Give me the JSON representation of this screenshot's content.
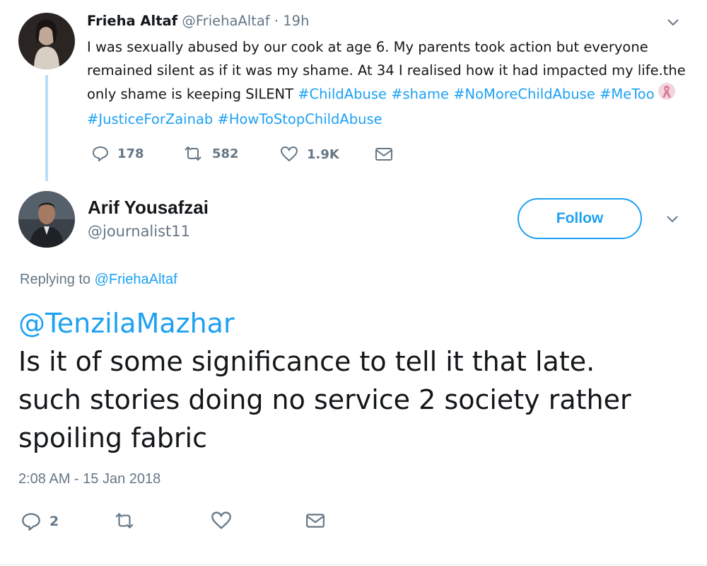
{
  "parent_tweet": {
    "author_name": "Frieha Altaf",
    "author_handle": "@FriehaAltaf",
    "time_separator": "·",
    "time": "19h",
    "text_plain": "I was sexually abused by our cook at age 6. My parents took action but everyone remained silent as if it was my shame. At 34 I realised how it had impacted my life.the only shame is keeping SILENT",
    "hashtags": [
      "#ChildAbuse",
      "#shame",
      "#NoMoreChildAbuse",
      "#MeToo",
      "#JusticeForZainab",
      "#HowToStopChildAbuse"
    ],
    "stats": {
      "replies": "178",
      "retweets": "582",
      "likes": "1.9K"
    }
  },
  "reply_tweet": {
    "author_name": "Arif Yousafzai",
    "author_handle": "@journalist11",
    "follow_label": "Follow",
    "replying_to_prefix": "Replying to",
    "replying_to_handle": "@FriehaAltaf",
    "mention": "@TenzilaMazhar",
    "text_lines": [
      "Is it of some significance to tell it that late.",
      "such stories doing no service 2 society rather",
      "spoiling fabric"
    ],
    "timestamp": "2:08 AM - 15 Jan 2018",
    "stats": {
      "replies": "2"
    }
  },
  "icons": {
    "reply": "reply-bubble-icon",
    "retweet": "retweet-icon",
    "like": "heart-icon",
    "dm": "envelope-icon",
    "caret": "chevron-down-icon",
    "emoji": "ribbon-emoji-icon"
  },
  "colors": {
    "accent": "#1da1f2",
    "muted": "#657786",
    "text": "#14171a",
    "thread_line": "#b9def6"
  }
}
